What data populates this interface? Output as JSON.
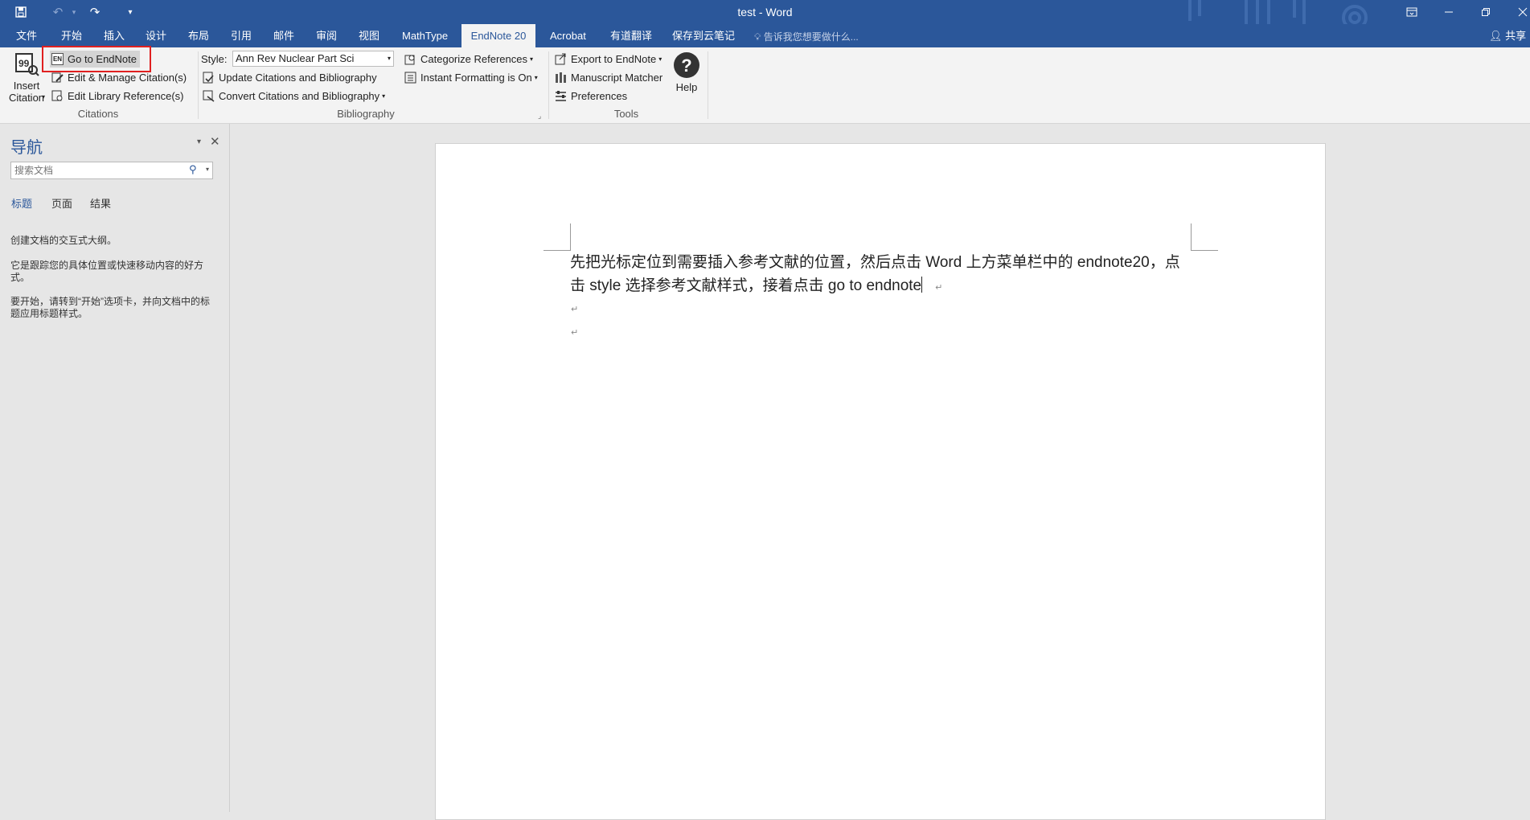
{
  "window": {
    "title": "test - Word",
    "accent": "#2b579a"
  },
  "tabs": [
    {
      "label": "文件"
    },
    {
      "label": "开始"
    },
    {
      "label": "插入"
    },
    {
      "label": "设计"
    },
    {
      "label": "布局"
    },
    {
      "label": "引用"
    },
    {
      "label": "邮件"
    },
    {
      "label": "审阅"
    },
    {
      "label": "视图"
    },
    {
      "label": "MathType"
    },
    {
      "label": "EndNote 20"
    },
    {
      "label": "Acrobat"
    },
    {
      "label": "有道翻译"
    },
    {
      "label": "保存到云笔记"
    }
  ],
  "active_tab": "EndNote 20",
  "tell_me": "告诉我您想要做什么...",
  "share": "共享",
  "ribbon": {
    "insert_citation": {
      "line1": "Insert",
      "line2": "Citation"
    },
    "go_to_endnote": "Go to EndNote",
    "edit_manage": "Edit & Manage Citation(s)",
    "edit_library": "Edit Library Reference(s)",
    "citations_group": "Citations",
    "style_label": "Style:",
    "style_value": "Ann Rev Nuclear Part Sci",
    "update_citations": "Update Citations and Bibliography",
    "convert_citations": "Convert Citations and Bibliography",
    "categorize": "Categorize References",
    "instant_formatting": "Instant Formatting is On",
    "bibliography_group": "Bibliography",
    "export": "Export to EndNote",
    "manuscript": "Manuscript Matcher",
    "preferences": "Preferences",
    "help": "Help",
    "tools_group": "Tools"
  },
  "nav": {
    "title": "导航",
    "search_placeholder": "搜索文档",
    "tabs": [
      {
        "label": "标题"
      },
      {
        "label": "页面"
      },
      {
        "label": "结果"
      }
    ],
    "msg1": "创建文档的交互式大纲。",
    "msg2": "它是跟踪您的具体位置或快速移动内容的好方式。",
    "msg3": "要开始，请转到“开始”选项卡，并向文档中的标题应用标题样式。"
  },
  "document": {
    "line1": "先把光标定位到需要插入参考文献的位置，然后点击 Word 上方菜单栏中的 endnote20，点",
    "line2": "击 style 选择参考文献样式，接着点击  go to endnote"
  }
}
